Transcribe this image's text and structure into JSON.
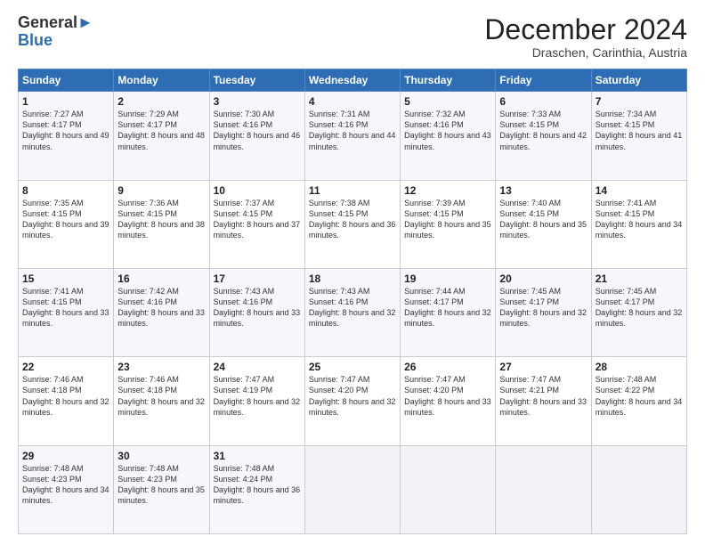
{
  "logo": {
    "general": "General",
    "blue": "Blue"
  },
  "title": "December 2024",
  "location": "Draschen, Carinthia, Austria",
  "days_of_week": [
    "Sunday",
    "Monday",
    "Tuesday",
    "Wednesday",
    "Thursday",
    "Friday",
    "Saturday"
  ],
  "weeks": [
    [
      {
        "day": "1",
        "sunrise": "Sunrise: 7:27 AM",
        "sunset": "Sunset: 4:17 PM",
        "daylight": "Daylight: 8 hours and 49 minutes."
      },
      {
        "day": "2",
        "sunrise": "Sunrise: 7:29 AM",
        "sunset": "Sunset: 4:17 PM",
        "daylight": "Daylight: 8 hours and 48 minutes."
      },
      {
        "day": "3",
        "sunrise": "Sunrise: 7:30 AM",
        "sunset": "Sunset: 4:16 PM",
        "daylight": "Daylight: 8 hours and 46 minutes."
      },
      {
        "day": "4",
        "sunrise": "Sunrise: 7:31 AM",
        "sunset": "Sunset: 4:16 PM",
        "daylight": "Daylight: 8 hours and 44 minutes."
      },
      {
        "day": "5",
        "sunrise": "Sunrise: 7:32 AM",
        "sunset": "Sunset: 4:16 PM",
        "daylight": "Daylight: 8 hours and 43 minutes."
      },
      {
        "day": "6",
        "sunrise": "Sunrise: 7:33 AM",
        "sunset": "Sunset: 4:15 PM",
        "daylight": "Daylight: 8 hours and 42 minutes."
      },
      {
        "day": "7",
        "sunrise": "Sunrise: 7:34 AM",
        "sunset": "Sunset: 4:15 PM",
        "daylight": "Daylight: 8 hours and 41 minutes."
      }
    ],
    [
      {
        "day": "8",
        "sunrise": "Sunrise: 7:35 AM",
        "sunset": "Sunset: 4:15 PM",
        "daylight": "Daylight: 8 hours and 39 minutes."
      },
      {
        "day": "9",
        "sunrise": "Sunrise: 7:36 AM",
        "sunset": "Sunset: 4:15 PM",
        "daylight": "Daylight: 8 hours and 38 minutes."
      },
      {
        "day": "10",
        "sunrise": "Sunrise: 7:37 AM",
        "sunset": "Sunset: 4:15 PM",
        "daylight": "Daylight: 8 hours and 37 minutes."
      },
      {
        "day": "11",
        "sunrise": "Sunrise: 7:38 AM",
        "sunset": "Sunset: 4:15 PM",
        "daylight": "Daylight: 8 hours and 36 minutes."
      },
      {
        "day": "12",
        "sunrise": "Sunrise: 7:39 AM",
        "sunset": "Sunset: 4:15 PM",
        "daylight": "Daylight: 8 hours and 35 minutes."
      },
      {
        "day": "13",
        "sunrise": "Sunrise: 7:40 AM",
        "sunset": "Sunset: 4:15 PM",
        "daylight": "Daylight: 8 hours and 35 minutes."
      },
      {
        "day": "14",
        "sunrise": "Sunrise: 7:41 AM",
        "sunset": "Sunset: 4:15 PM",
        "daylight": "Daylight: 8 hours and 34 minutes."
      }
    ],
    [
      {
        "day": "15",
        "sunrise": "Sunrise: 7:41 AM",
        "sunset": "Sunset: 4:15 PM",
        "daylight": "Daylight: 8 hours and 33 minutes."
      },
      {
        "day": "16",
        "sunrise": "Sunrise: 7:42 AM",
        "sunset": "Sunset: 4:16 PM",
        "daylight": "Daylight: 8 hours and 33 minutes."
      },
      {
        "day": "17",
        "sunrise": "Sunrise: 7:43 AM",
        "sunset": "Sunset: 4:16 PM",
        "daylight": "Daylight: 8 hours and 33 minutes."
      },
      {
        "day": "18",
        "sunrise": "Sunrise: 7:43 AM",
        "sunset": "Sunset: 4:16 PM",
        "daylight": "Daylight: 8 hours and 32 minutes."
      },
      {
        "day": "19",
        "sunrise": "Sunrise: 7:44 AM",
        "sunset": "Sunset: 4:17 PM",
        "daylight": "Daylight: 8 hours and 32 minutes."
      },
      {
        "day": "20",
        "sunrise": "Sunrise: 7:45 AM",
        "sunset": "Sunset: 4:17 PM",
        "daylight": "Daylight: 8 hours and 32 minutes."
      },
      {
        "day": "21",
        "sunrise": "Sunrise: 7:45 AM",
        "sunset": "Sunset: 4:17 PM",
        "daylight": "Daylight: 8 hours and 32 minutes."
      }
    ],
    [
      {
        "day": "22",
        "sunrise": "Sunrise: 7:46 AM",
        "sunset": "Sunset: 4:18 PM",
        "daylight": "Daylight: 8 hours and 32 minutes."
      },
      {
        "day": "23",
        "sunrise": "Sunrise: 7:46 AM",
        "sunset": "Sunset: 4:18 PM",
        "daylight": "Daylight: 8 hours and 32 minutes."
      },
      {
        "day": "24",
        "sunrise": "Sunrise: 7:47 AM",
        "sunset": "Sunset: 4:19 PM",
        "daylight": "Daylight: 8 hours and 32 minutes."
      },
      {
        "day": "25",
        "sunrise": "Sunrise: 7:47 AM",
        "sunset": "Sunset: 4:20 PM",
        "daylight": "Daylight: 8 hours and 32 minutes."
      },
      {
        "day": "26",
        "sunrise": "Sunrise: 7:47 AM",
        "sunset": "Sunset: 4:20 PM",
        "daylight": "Daylight: 8 hours and 33 minutes."
      },
      {
        "day": "27",
        "sunrise": "Sunrise: 7:47 AM",
        "sunset": "Sunset: 4:21 PM",
        "daylight": "Daylight: 8 hours and 33 minutes."
      },
      {
        "day": "28",
        "sunrise": "Sunrise: 7:48 AM",
        "sunset": "Sunset: 4:22 PM",
        "daylight": "Daylight: 8 hours and 34 minutes."
      }
    ],
    [
      {
        "day": "29",
        "sunrise": "Sunrise: 7:48 AM",
        "sunset": "Sunset: 4:23 PM",
        "daylight": "Daylight: 8 hours and 34 minutes."
      },
      {
        "day": "30",
        "sunrise": "Sunrise: 7:48 AM",
        "sunset": "Sunset: 4:23 PM",
        "daylight": "Daylight: 8 hours and 35 minutes."
      },
      {
        "day": "31",
        "sunrise": "Sunrise: 7:48 AM",
        "sunset": "Sunset: 4:24 PM",
        "daylight": "Daylight: 8 hours and 36 minutes."
      },
      null,
      null,
      null,
      null
    ]
  ]
}
